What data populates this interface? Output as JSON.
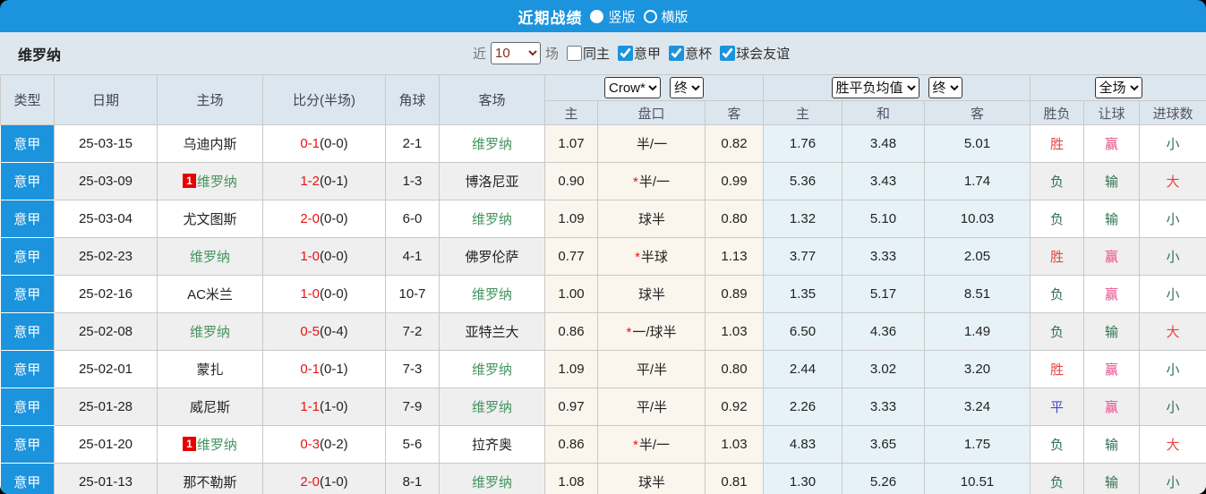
{
  "colors": {
    "bar_blue": "#1b93dd",
    "score_red": "#e81414",
    "team_green": "#44945e",
    "result_red": "#e24646",
    "result_green": "#2f7252",
    "result_blue": "#4747d9",
    "result_pink": "#eb4d8c",
    "odds_bg": "#faf6ee",
    "mean_bg": "#e6f2f8"
  },
  "titlebar": {
    "title": "近期战绩",
    "radios": [
      {
        "label": "竖版",
        "selected": true
      },
      {
        "label": "横版",
        "selected": false
      }
    ]
  },
  "filterbar": {
    "team": "维罗纳",
    "recent_label": "近",
    "recent_value": "10",
    "games_label": "场",
    "checkboxes": [
      {
        "label": "同主",
        "checked": false
      },
      {
        "label": "意甲",
        "checked": true
      },
      {
        "label": "意杯",
        "checked": true
      },
      {
        "label": "球会友谊",
        "checked": true
      }
    ]
  },
  "table": {
    "headers": [
      "类型",
      "日期",
      "主场",
      "比分(半场)",
      "角球",
      "客场"
    ],
    "selects": {
      "odds_company": "Crow*",
      "odds_time": "终",
      "mean_label": "胜平负均值",
      "mean_time": "终",
      "scope": "全场"
    },
    "sub_headers": [
      "主",
      "盘口",
      "客",
      "主",
      "和",
      "客",
      "胜负",
      "让球",
      "进球数"
    ],
    "rows": [
      {
        "league": "意甲",
        "date": "25-03-15",
        "home": "乌迪内斯",
        "home_verona": false,
        "home_badge": "",
        "score": "0-1",
        "half": "(0-0)",
        "corner": "2-1",
        "away": "维罗纳",
        "away_verona": true,
        "o1": "1.07",
        "star": false,
        "hcap": "半/一",
        "o2": "0.82",
        "m1": "1.76",
        "m2": "3.48",
        "m3": "5.01",
        "r1": "胜",
        "c1": "red",
        "r2": "赢",
        "c2": "pink",
        "r3": "小",
        "c3": "green"
      },
      {
        "league": "意甲",
        "date": "25-03-09",
        "home": "维罗纳",
        "home_verona": true,
        "home_badge": "1",
        "score": "1-2",
        "half": "(0-1)",
        "corner": "1-3",
        "away": "博洛尼亚",
        "away_verona": false,
        "o1": "0.90",
        "star": true,
        "hcap": "半/一",
        "o2": "0.99",
        "m1": "5.36",
        "m2": "3.43",
        "m3": "1.74",
        "r1": "负",
        "c1": "green",
        "r2": "输",
        "c2": "green",
        "r3": "大",
        "c3": "red"
      },
      {
        "league": "意甲",
        "date": "25-03-04",
        "home": "尤文图斯",
        "home_verona": false,
        "home_badge": "",
        "score": "2-0",
        "half": "(0-0)",
        "corner": "6-0",
        "away": "维罗纳",
        "away_verona": true,
        "o1": "1.09",
        "star": false,
        "hcap": "球半",
        "o2": "0.80",
        "m1": "1.32",
        "m2": "5.10",
        "m3": "10.03",
        "r1": "负",
        "c1": "green",
        "r2": "输",
        "c2": "green",
        "r3": "小",
        "c3": "green"
      },
      {
        "league": "意甲",
        "date": "25-02-23",
        "home": "维罗纳",
        "home_verona": true,
        "home_badge": "",
        "score": "1-0",
        "half": "(0-0)",
        "corner": "4-1",
        "away": "佛罗伦萨",
        "away_verona": false,
        "o1": "0.77",
        "star": true,
        "hcap": "半球",
        "o2": "1.13",
        "m1": "3.77",
        "m2": "3.33",
        "m3": "2.05",
        "r1": "胜",
        "c1": "red",
        "r2": "赢",
        "c2": "pink",
        "r3": "小",
        "c3": "green"
      },
      {
        "league": "意甲",
        "date": "25-02-16",
        "home": "AC米兰",
        "home_verona": false,
        "home_badge": "",
        "score": "1-0",
        "half": "(0-0)",
        "corner": "10-7",
        "away": "维罗纳",
        "away_verona": true,
        "o1": "1.00",
        "star": false,
        "hcap": "球半",
        "o2": "0.89",
        "m1": "1.35",
        "m2": "5.17",
        "m3": "8.51",
        "r1": "负",
        "c1": "green",
        "r2": "赢",
        "c2": "pink",
        "r3": "小",
        "c3": "green"
      },
      {
        "league": "意甲",
        "date": "25-02-08",
        "home": "维罗纳",
        "home_verona": true,
        "home_badge": "",
        "score": "0-5",
        "half": "(0-4)",
        "corner": "7-2",
        "away": "亚特兰大",
        "away_verona": false,
        "o1": "0.86",
        "star": true,
        "hcap": "一/球半",
        "o2": "1.03",
        "m1": "6.50",
        "m2": "4.36",
        "m3": "1.49",
        "r1": "负",
        "c1": "green",
        "r2": "输",
        "c2": "green",
        "r3": "大",
        "c3": "red"
      },
      {
        "league": "意甲",
        "date": "25-02-01",
        "home": "蒙扎",
        "home_verona": false,
        "home_badge": "",
        "score": "0-1",
        "half": "(0-1)",
        "corner": "7-3",
        "away": "维罗纳",
        "away_verona": true,
        "o1": "1.09",
        "star": false,
        "hcap": "平/半",
        "o2": "0.80",
        "m1": "2.44",
        "m2": "3.02",
        "m3": "3.20",
        "r1": "胜",
        "c1": "red",
        "r2": "赢",
        "c2": "pink",
        "r3": "小",
        "c3": "green"
      },
      {
        "league": "意甲",
        "date": "25-01-28",
        "home": "威尼斯",
        "home_verona": false,
        "home_badge": "",
        "score": "1-1",
        "half": "(1-0)",
        "corner": "7-9",
        "away": "维罗纳",
        "away_verona": true,
        "o1": "0.97",
        "star": false,
        "hcap": "平/半",
        "o2": "0.92",
        "m1": "2.26",
        "m2": "3.33",
        "m3": "3.24",
        "r1": "平",
        "c1": "blue",
        "r2": "赢",
        "c2": "pink",
        "r3": "小",
        "c3": "green"
      },
      {
        "league": "意甲",
        "date": "25-01-20",
        "home": "维罗纳",
        "home_verona": true,
        "home_badge": "1",
        "score": "0-3",
        "half": "(0-2)",
        "corner": "5-6",
        "away": "拉齐奥",
        "away_verona": false,
        "o1": "0.86",
        "star": true,
        "hcap": "半/一",
        "o2": "1.03",
        "m1": "4.83",
        "m2": "3.65",
        "m3": "1.75",
        "r1": "负",
        "c1": "green",
        "r2": "输",
        "c2": "green",
        "r3": "大",
        "c3": "red"
      },
      {
        "league": "意甲",
        "date": "25-01-13",
        "home": "那不勒斯",
        "home_verona": false,
        "home_badge": "",
        "score": "2-0",
        "half": "(1-0)",
        "corner": "8-1",
        "away": "维罗纳",
        "away_verona": true,
        "o1": "1.08",
        "star": false,
        "hcap": "球半",
        "o2": "0.81",
        "m1": "1.30",
        "m2": "5.26",
        "m3": "10.51",
        "r1": "负",
        "c1": "green",
        "r2": "输",
        "c2": "green",
        "r3": "小",
        "c3": "green"
      }
    ]
  }
}
